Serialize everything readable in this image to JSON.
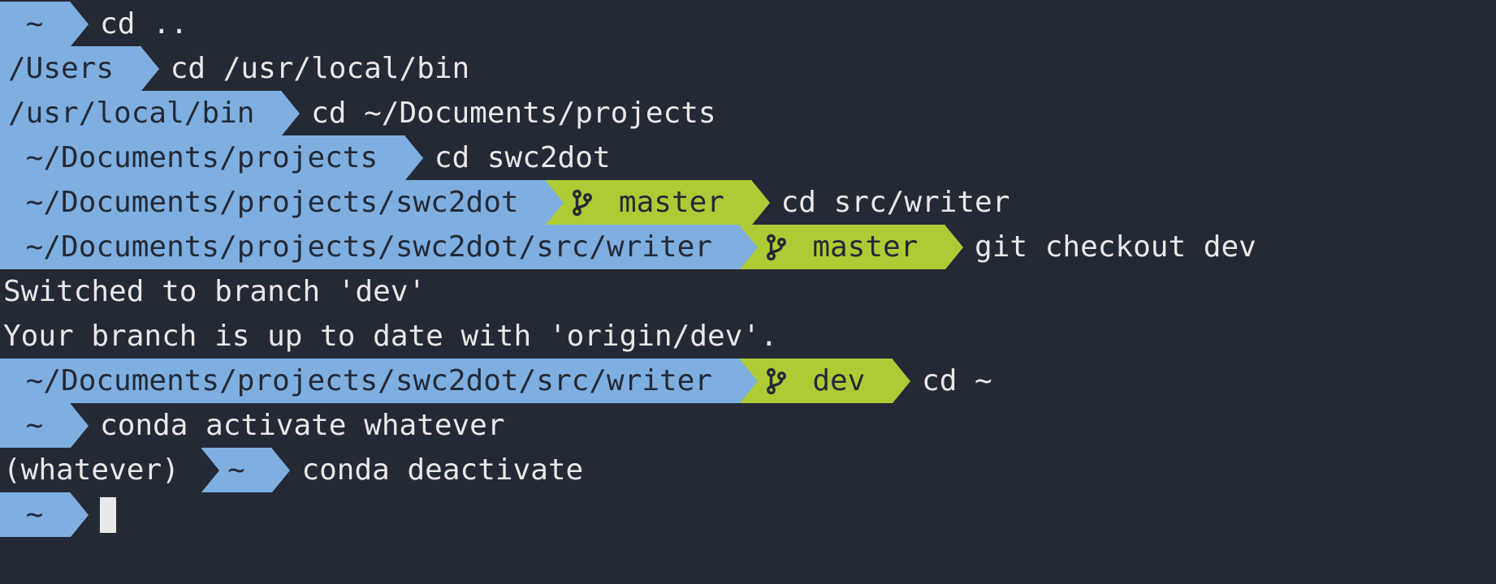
{
  "colors": {
    "bg": "#242936",
    "path_bg": "#7eafe0",
    "git_bg": "#aecb35",
    "fg": "#e8e8e8",
    "seg_fg": "#242936"
  },
  "lines": [
    {
      "segments": [
        {
          "type": "path",
          "text": " ~ "
        }
      ],
      "command": "cd .."
    },
    {
      "segments": [
        {
          "type": "path",
          "text": "/Users "
        }
      ],
      "command": "cd /usr/local/bin"
    },
    {
      "segments": [
        {
          "type": "path",
          "text": "/usr/local/bin "
        }
      ],
      "command": "cd ~/Documents/projects"
    },
    {
      "segments": [
        {
          "type": "path",
          "text": " ~/Documents/projects "
        }
      ],
      "command": "cd swc2dot"
    },
    {
      "segments": [
        {
          "type": "path",
          "text": " ~/Documents/projects/swc2dot "
        },
        {
          "type": "git",
          "text": " master "
        }
      ],
      "command": "cd src/writer"
    },
    {
      "segments": [
        {
          "type": "path",
          "text": " ~/Documents/projects/swc2dot/src/writer "
        },
        {
          "type": "git",
          "text": " master "
        }
      ],
      "command": "git checkout dev"
    },
    {
      "output": "Switched to branch 'dev'"
    },
    {
      "output": "Your branch is up to date with 'origin/dev'."
    },
    {
      "segments": [
        {
          "type": "path",
          "text": " ~/Documents/projects/swc2dot/src/writer "
        },
        {
          "type": "git",
          "text": " dev "
        }
      ],
      "command": "cd ~"
    },
    {
      "segments": [
        {
          "type": "path",
          "text": " ~ "
        }
      ],
      "command": "conda activate whatever"
    },
    {
      "env": "(whatever) ",
      "segments": [
        {
          "type": "path",
          "text": " ~ "
        }
      ],
      "command": "conda deactivate"
    },
    {
      "segments": [
        {
          "type": "path",
          "text": " ~ "
        }
      ],
      "cursor": true
    }
  ],
  "icons": {
    "branch": "git-branch-icon"
  }
}
